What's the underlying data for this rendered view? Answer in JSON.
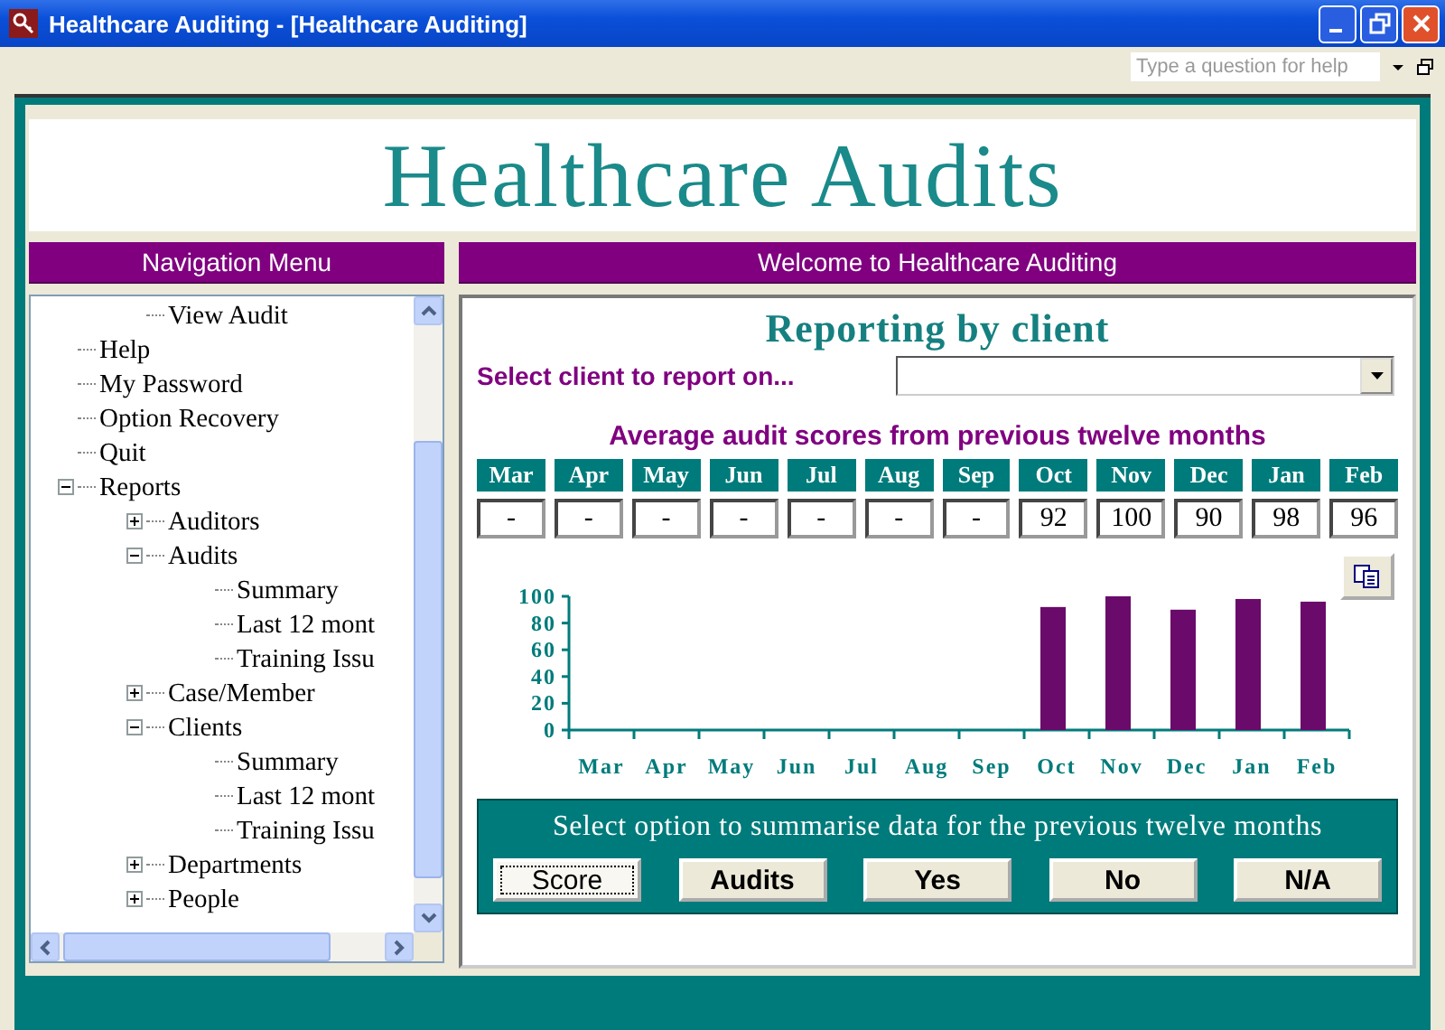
{
  "window": {
    "title": "Healthcare Auditing - [Healthcare Auditing]"
  },
  "help_field": {
    "placeholder": "Type a question for help"
  },
  "header": {
    "title": "Healthcare Audits"
  },
  "navigation": {
    "title": "Navigation Menu",
    "items": [
      {
        "children": [
          {
            "label": "View Audit"
          }
        ]
      },
      {
        "label": "Help"
      },
      {
        "label": "My Password"
      },
      {
        "label": "Option Recovery"
      },
      {
        "label": "Quit"
      },
      {
        "label": "Reports",
        "expanded": true,
        "children": [
          {
            "label": "Auditors",
            "expanded": false
          },
          {
            "label": "Audits",
            "expanded": true,
            "children": [
              {
                "label": "Summary"
              },
              {
                "label": "Last 12 mont"
              },
              {
                "label": "Training Issu"
              }
            ]
          },
          {
            "label": "Case/Member",
            "expanded": false
          },
          {
            "label": "Clients",
            "expanded": true,
            "children": [
              {
                "label": "Summary"
              },
              {
                "label": "Last 12 mont"
              },
              {
                "label": "Training Issu"
              }
            ]
          },
          {
            "label": "Departments",
            "expanded": false
          },
          {
            "label": "People",
            "expanded": false
          }
        ]
      }
    ]
  },
  "main": {
    "title": "Welcome to Healthcare Auditing",
    "heading": "Reporting by client",
    "client_label": "Select client to report on...",
    "scores": {
      "title": "Average audit scores from previous twelve months",
      "months": [
        {
          "month": "Mar",
          "score": "-"
        },
        {
          "month": "Apr",
          "score": "-"
        },
        {
          "month": "May",
          "score": "-"
        },
        {
          "month": "Jun",
          "score": "-"
        },
        {
          "month": "Jul",
          "score": "-"
        },
        {
          "month": "Aug",
          "score": "-"
        },
        {
          "month": "Sep",
          "score": "-"
        },
        {
          "month": "Oct",
          "score": "92"
        },
        {
          "month": "Nov",
          "score": "100"
        },
        {
          "month": "Dec",
          "score": "90"
        },
        {
          "month": "Jan",
          "score": "98"
        },
        {
          "month": "Feb",
          "score": "96"
        }
      ]
    },
    "chart_data": {
      "type": "bar",
      "categories": [
        "Mar",
        "Apr",
        "May",
        "Jun",
        "Jul",
        "Aug",
        "Sep",
        "Oct",
        "Nov",
        "Dec",
        "Jan",
        "Feb"
      ],
      "series": [
        {
          "color": "#6a0a6a",
          "values": [
            null,
            null,
            null,
            null,
            null,
            null,
            null,
            92,
            100,
            90,
            98,
            96
          ]
        }
      ],
      "ylim": [
        0,
        100
      ],
      "yticks": [
        0,
        20,
        40,
        60,
        80,
        100
      ]
    },
    "summary": {
      "title": "Select option to summarise data for the previous twelve months",
      "options": [
        {
          "label": "Score",
          "selected": true
        },
        {
          "label": "Audits",
          "selected": false
        },
        {
          "label": "Yes",
          "selected": false
        },
        {
          "label": "No",
          "selected": false
        },
        {
          "label": "N/A",
          "selected": false
        }
      ]
    }
  }
}
